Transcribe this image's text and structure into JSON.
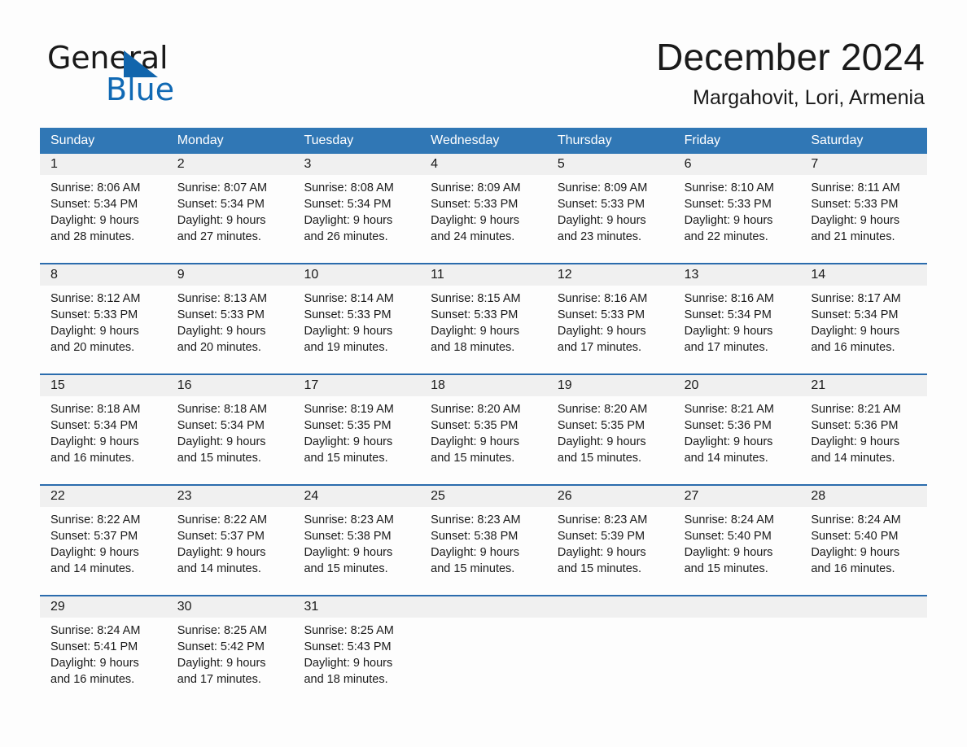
{
  "brand": {
    "name_part1": "General",
    "name_part2": "Blue",
    "triangle_color": "#1165ac",
    "blue_color": "#1069b4"
  },
  "header": {
    "title": "December 2024",
    "subtitle": "Margahovit, Lori, Armenia"
  },
  "theme": {
    "header_bar_color": "#3077b5",
    "row_divider_color": "#2b6cad",
    "day_band_color": "#f0f0f0",
    "page_background": "#fdfdfd"
  },
  "weekdays": [
    "Sunday",
    "Monday",
    "Tuesday",
    "Wednesday",
    "Thursday",
    "Friday",
    "Saturday"
  ],
  "weeks": [
    [
      {
        "day": "1",
        "sunrise": "Sunrise: 8:06 AM",
        "sunset": "Sunset: 5:34 PM",
        "daylight_line1": "Daylight: 9 hours",
        "daylight_line2": "and 28 minutes."
      },
      {
        "day": "2",
        "sunrise": "Sunrise: 8:07 AM",
        "sunset": "Sunset: 5:34 PM",
        "daylight_line1": "Daylight: 9 hours",
        "daylight_line2": "and 27 minutes."
      },
      {
        "day": "3",
        "sunrise": "Sunrise: 8:08 AM",
        "sunset": "Sunset: 5:34 PM",
        "daylight_line1": "Daylight: 9 hours",
        "daylight_line2": "and 26 minutes."
      },
      {
        "day": "4",
        "sunrise": "Sunrise: 8:09 AM",
        "sunset": "Sunset: 5:33 PM",
        "daylight_line1": "Daylight: 9 hours",
        "daylight_line2": "and 24 minutes."
      },
      {
        "day": "5",
        "sunrise": "Sunrise: 8:09 AM",
        "sunset": "Sunset: 5:33 PM",
        "daylight_line1": "Daylight: 9 hours",
        "daylight_line2": "and 23 minutes."
      },
      {
        "day": "6",
        "sunrise": "Sunrise: 8:10 AM",
        "sunset": "Sunset: 5:33 PM",
        "daylight_line1": "Daylight: 9 hours",
        "daylight_line2": "and 22 minutes."
      },
      {
        "day": "7",
        "sunrise": "Sunrise: 8:11 AM",
        "sunset": "Sunset: 5:33 PM",
        "daylight_line1": "Daylight: 9 hours",
        "daylight_line2": "and 21 minutes."
      }
    ],
    [
      {
        "day": "8",
        "sunrise": "Sunrise: 8:12 AM",
        "sunset": "Sunset: 5:33 PM",
        "daylight_line1": "Daylight: 9 hours",
        "daylight_line2": "and 20 minutes."
      },
      {
        "day": "9",
        "sunrise": "Sunrise: 8:13 AM",
        "sunset": "Sunset: 5:33 PM",
        "daylight_line1": "Daylight: 9 hours",
        "daylight_line2": "and 20 minutes."
      },
      {
        "day": "10",
        "sunrise": "Sunrise: 8:14 AM",
        "sunset": "Sunset: 5:33 PM",
        "daylight_line1": "Daylight: 9 hours",
        "daylight_line2": "and 19 minutes."
      },
      {
        "day": "11",
        "sunrise": "Sunrise: 8:15 AM",
        "sunset": "Sunset: 5:33 PM",
        "daylight_line1": "Daylight: 9 hours",
        "daylight_line2": "and 18 minutes."
      },
      {
        "day": "12",
        "sunrise": "Sunrise: 8:16 AM",
        "sunset": "Sunset: 5:33 PM",
        "daylight_line1": "Daylight: 9 hours",
        "daylight_line2": "and 17 minutes."
      },
      {
        "day": "13",
        "sunrise": "Sunrise: 8:16 AM",
        "sunset": "Sunset: 5:34 PM",
        "daylight_line1": "Daylight: 9 hours",
        "daylight_line2": "and 17 minutes."
      },
      {
        "day": "14",
        "sunrise": "Sunrise: 8:17 AM",
        "sunset": "Sunset: 5:34 PM",
        "daylight_line1": "Daylight: 9 hours",
        "daylight_line2": "and 16 minutes."
      }
    ],
    [
      {
        "day": "15",
        "sunrise": "Sunrise: 8:18 AM",
        "sunset": "Sunset: 5:34 PM",
        "daylight_line1": "Daylight: 9 hours",
        "daylight_line2": "and 16 minutes."
      },
      {
        "day": "16",
        "sunrise": "Sunrise: 8:18 AM",
        "sunset": "Sunset: 5:34 PM",
        "daylight_line1": "Daylight: 9 hours",
        "daylight_line2": "and 15 minutes."
      },
      {
        "day": "17",
        "sunrise": "Sunrise: 8:19 AM",
        "sunset": "Sunset: 5:35 PM",
        "daylight_line1": "Daylight: 9 hours",
        "daylight_line2": "and 15 minutes."
      },
      {
        "day": "18",
        "sunrise": "Sunrise: 8:20 AM",
        "sunset": "Sunset: 5:35 PM",
        "daylight_line1": "Daylight: 9 hours",
        "daylight_line2": "and 15 minutes."
      },
      {
        "day": "19",
        "sunrise": "Sunrise: 8:20 AM",
        "sunset": "Sunset: 5:35 PM",
        "daylight_line1": "Daylight: 9 hours",
        "daylight_line2": "and 15 minutes."
      },
      {
        "day": "20",
        "sunrise": "Sunrise: 8:21 AM",
        "sunset": "Sunset: 5:36 PM",
        "daylight_line1": "Daylight: 9 hours",
        "daylight_line2": "and 14 minutes."
      },
      {
        "day": "21",
        "sunrise": "Sunrise: 8:21 AM",
        "sunset": "Sunset: 5:36 PM",
        "daylight_line1": "Daylight: 9 hours",
        "daylight_line2": "and 14 minutes."
      }
    ],
    [
      {
        "day": "22",
        "sunrise": "Sunrise: 8:22 AM",
        "sunset": "Sunset: 5:37 PM",
        "daylight_line1": "Daylight: 9 hours",
        "daylight_line2": "and 14 minutes."
      },
      {
        "day": "23",
        "sunrise": "Sunrise: 8:22 AM",
        "sunset": "Sunset: 5:37 PM",
        "daylight_line1": "Daylight: 9 hours",
        "daylight_line2": "and 14 minutes."
      },
      {
        "day": "24",
        "sunrise": "Sunrise: 8:23 AM",
        "sunset": "Sunset: 5:38 PM",
        "daylight_line1": "Daylight: 9 hours",
        "daylight_line2": "and 15 minutes."
      },
      {
        "day": "25",
        "sunrise": "Sunrise: 8:23 AM",
        "sunset": "Sunset: 5:38 PM",
        "daylight_line1": "Daylight: 9 hours",
        "daylight_line2": "and 15 minutes."
      },
      {
        "day": "26",
        "sunrise": "Sunrise: 8:23 AM",
        "sunset": "Sunset: 5:39 PM",
        "daylight_line1": "Daylight: 9 hours",
        "daylight_line2": "and 15 minutes."
      },
      {
        "day": "27",
        "sunrise": "Sunrise: 8:24 AM",
        "sunset": "Sunset: 5:40 PM",
        "daylight_line1": "Daylight: 9 hours",
        "daylight_line2": "and 15 minutes."
      },
      {
        "day": "28",
        "sunrise": "Sunrise: 8:24 AM",
        "sunset": "Sunset: 5:40 PM",
        "daylight_line1": "Daylight: 9 hours",
        "daylight_line2": "and 16 minutes."
      }
    ],
    [
      {
        "day": "29",
        "sunrise": "Sunrise: 8:24 AM",
        "sunset": "Sunset: 5:41 PM",
        "daylight_line1": "Daylight: 9 hours",
        "daylight_line2": "and 16 minutes."
      },
      {
        "day": "30",
        "sunrise": "Sunrise: 8:25 AM",
        "sunset": "Sunset: 5:42 PM",
        "daylight_line1": "Daylight: 9 hours",
        "daylight_line2": "and 17 minutes."
      },
      {
        "day": "31",
        "sunrise": "Sunrise: 8:25 AM",
        "sunset": "Sunset: 5:43 PM",
        "daylight_line1": "Daylight: 9 hours",
        "daylight_line2": "and 18 minutes."
      },
      {
        "day": "",
        "sunrise": "",
        "sunset": "",
        "daylight_line1": "",
        "daylight_line2": ""
      },
      {
        "day": "",
        "sunrise": "",
        "sunset": "",
        "daylight_line1": "",
        "daylight_line2": ""
      },
      {
        "day": "",
        "sunrise": "",
        "sunset": "",
        "daylight_line1": "",
        "daylight_line2": ""
      },
      {
        "day": "",
        "sunrise": "",
        "sunset": "",
        "daylight_line1": "",
        "daylight_line2": ""
      }
    ]
  ]
}
